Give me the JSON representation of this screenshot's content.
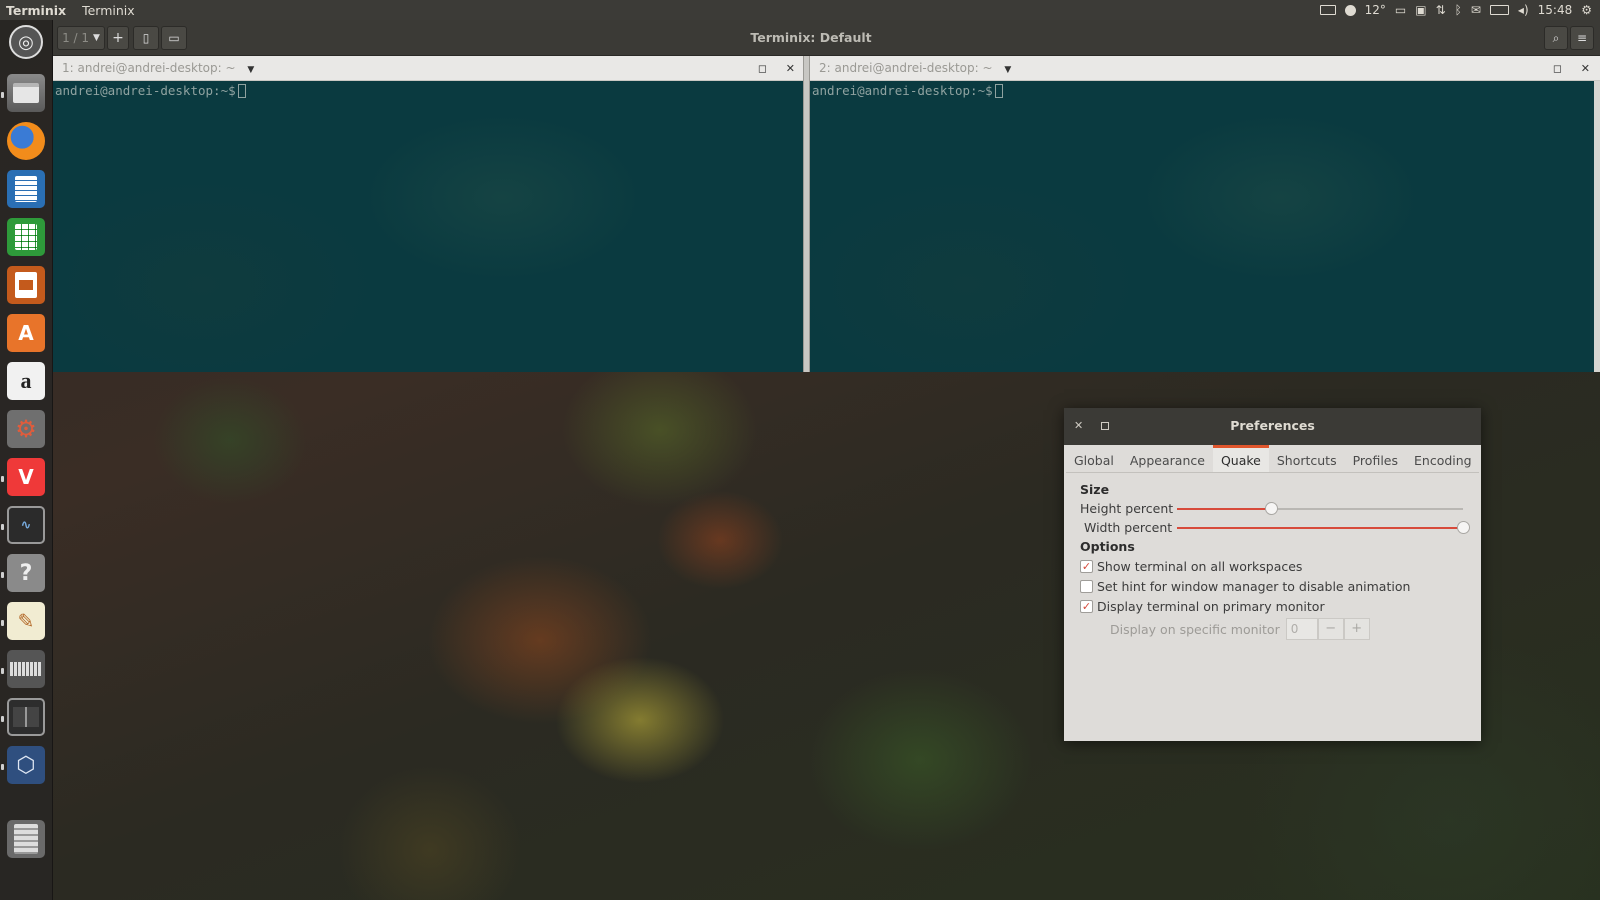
{
  "top_panel": {
    "app_name": "Terminix",
    "menu_label": "Terminix",
    "temperature": "12°",
    "clock": "15:48",
    "indicator_icons": [
      "keyboard-icon",
      "weather-icon",
      "drive-icon",
      "workspace-icon",
      "network-icon",
      "bluetooth-icon",
      "mail-icon",
      "battery-icon",
      "volume-icon",
      "power-icon"
    ]
  },
  "launcher": {
    "items": [
      "ubuntu-dash-icon",
      "files-icon",
      "firefox-icon",
      "writer-icon",
      "calc-icon",
      "impress-icon",
      "software-center-icon",
      "amazon-icon",
      "system-settings-icon",
      "vivaldi-icon",
      "system-monitor-icon",
      "help-icon",
      "text-editor-icon",
      "keyboard-icon",
      "terminix-icon",
      "virtualbox-icon",
      "trash-icon"
    ]
  },
  "terminal": {
    "window_title": "Terminix: Default",
    "session_label": "1 / 1",
    "panes": [
      {
        "title": "1: andrei@andrei-desktop: ~",
        "prompt": "andrei@andrei-desktop:~$"
      },
      {
        "title": "2: andrei@andrei-desktop: ~",
        "prompt": "andrei@andrei-desktop:~$"
      }
    ]
  },
  "preferences": {
    "title": "Preferences",
    "tabs": [
      "Global",
      "Appearance",
      "Quake",
      "Shortcuts",
      "Profiles",
      "Encoding"
    ],
    "active_tab": "Quake",
    "size_heading": "Size",
    "height_label": "Height percent",
    "height_value": 0.33,
    "width_label": "Width percent",
    "width_value": 1.0,
    "options_heading": "Options",
    "options": [
      {
        "label": "Show terminal on all workspaces",
        "checked": true
      },
      {
        "label": "Set hint for window manager to disable animation",
        "checked": false
      },
      {
        "label": "Display terminal on primary monitor",
        "checked": true
      }
    ],
    "monitor_label": "Display on specific monitor",
    "monitor_value": "0",
    "minus": "−",
    "plus": "+"
  },
  "colors": {
    "accent": "#d74a3b",
    "terminal_bg": "#0a3a40",
    "panel_bg": "#3c3b37"
  }
}
